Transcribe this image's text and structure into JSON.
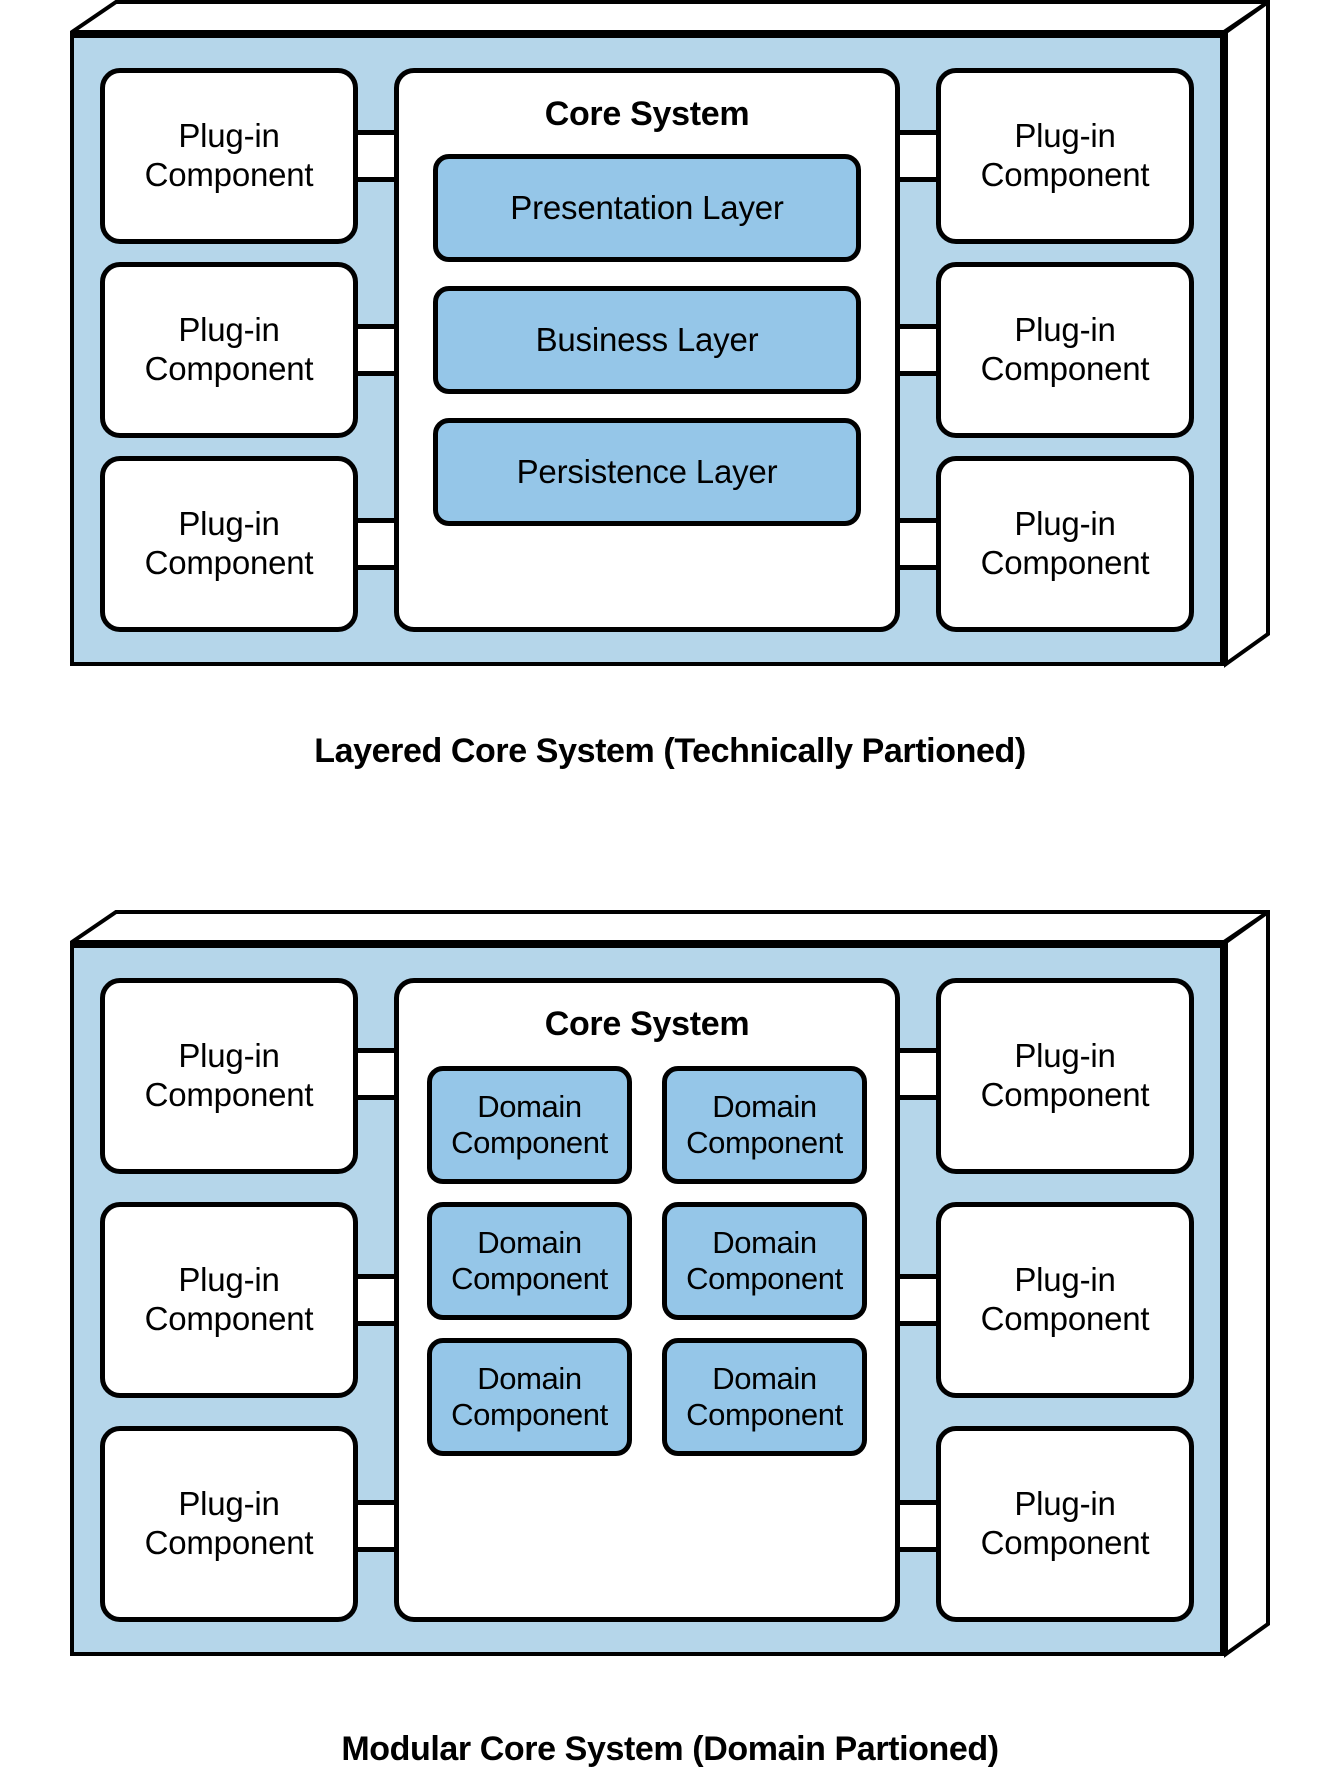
{
  "colors": {
    "frame_fill": "#b5d6ea",
    "component_fill": "#95c6e8",
    "box_fill": "#ffffff",
    "stroke": "#000000"
  },
  "figures": [
    {
      "id": "layered",
      "caption": "Layered Core System (Technically Partioned)",
      "core_title": "Core System",
      "left_plugins": [
        {
          "line1": "Plug-in",
          "line2": "Component"
        },
        {
          "line1": "Plug-in",
          "line2": "Component"
        },
        {
          "line1": "Plug-in",
          "line2": "Component"
        }
      ],
      "right_plugins": [
        {
          "line1": "Plug-in",
          "line2": "Component"
        },
        {
          "line1": "Plug-in",
          "line2": "Component"
        },
        {
          "line1": "Plug-in",
          "line2": "Component"
        }
      ],
      "layers": [
        {
          "label": "Presentation Layer"
        },
        {
          "label": "Business Layer"
        },
        {
          "label": "Persistence Layer"
        }
      ]
    },
    {
      "id": "modular",
      "caption": "Modular Core System (Domain Partioned)",
      "core_title": "Core System",
      "left_plugins": [
        {
          "line1": "Plug-in",
          "line2": "Component"
        },
        {
          "line1": "Plug-in",
          "line2": "Component"
        },
        {
          "line1": "Plug-in",
          "line2": "Component"
        }
      ],
      "right_plugins": [
        {
          "line1": "Plug-in",
          "line2": "Component"
        },
        {
          "line1": "Plug-in",
          "line2": "Component"
        },
        {
          "line1": "Plug-in",
          "line2": "Component"
        }
      ],
      "domain_components": [
        {
          "line1": "Domain",
          "line2": "Component"
        },
        {
          "line1": "Domain",
          "line2": "Component"
        },
        {
          "line1": "Domain",
          "line2": "Component"
        },
        {
          "line1": "Domain",
          "line2": "Component"
        },
        {
          "line1": "Domain",
          "line2": "Component"
        },
        {
          "line1": "Domain",
          "line2": "Component"
        }
      ]
    }
  ]
}
